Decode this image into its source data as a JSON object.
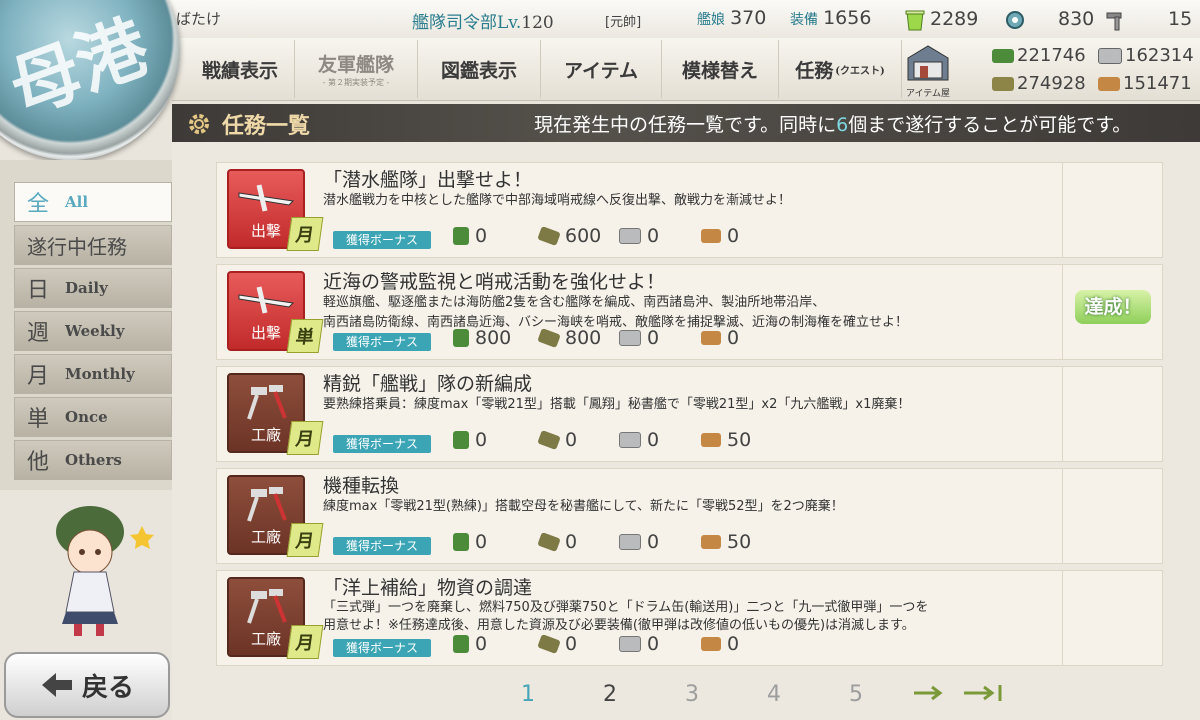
{
  "header": {
    "player_name": "ばたけ",
    "hq_label": "艦隊司令部",
    "level_prefix": "Lv.",
    "level": "120",
    "rank": "[元帥]",
    "ships_label": "艦娘",
    "ships": "370",
    "equip_label": "装備",
    "equip": "1656",
    "buckets": "2289",
    "dev_materials": "830",
    "screws": "15"
  },
  "nav": {
    "items": [
      {
        "label": "戦績表示"
      },
      {
        "label": "友軍艦隊",
        "sub": "- 第２期実装予定 -"
      },
      {
        "label": "図鑑表示"
      },
      {
        "label": "アイテム"
      },
      {
        "label": "模様替え"
      },
      {
        "label": "任務",
        "sub": "(クエスト)"
      }
    ],
    "item_shop_label": "アイテム屋"
  },
  "resources": {
    "fuel": "221746",
    "steel": "162314",
    "ammo": "274928",
    "bauxite": "151471"
  },
  "quest_header": {
    "title": "任務一覧",
    "msg_before": "現在発生中の任務一覧です。同時に",
    "msg_count": "6",
    "msg_after": "個まで遂行することが可能です。"
  },
  "filters": [
    {
      "kanji": "全",
      "label": "All"
    },
    {
      "kanji": "遂行中任務",
      "label": ""
    },
    {
      "kanji": "日",
      "label": "Daily"
    },
    {
      "kanji": "週",
      "label": "Weekly"
    },
    {
      "kanji": "月",
      "label": "Monthly"
    },
    {
      "kanji": "単",
      "label": "Once"
    },
    {
      "kanji": "他",
      "label": "Others"
    }
  ],
  "bonus_label": "獲得ボーナス",
  "quests": [
    {
      "category": "出撃",
      "tag": "月",
      "title": "「潜水艦隊」出撃せよ！",
      "desc": [
        "潜水艦戦力を中核とした艦隊で中部海域哨戒線へ反復出撃、敵戦力を漸減せよ！"
      ],
      "fuel": "0",
      "ammo": "600",
      "steel": "0",
      "baux": "0"
    },
    {
      "category": "出撃",
      "tag": "単",
      "title": "近海の警戒監視と哨戒活動を強化せよ！",
      "desc": [
        "軽巡旗艦、駆逐艦または海防艦2隻を含む艦隊を編成、南西諸島沖、製油所地帯沿岸、",
        "南西諸島防衛線、南西諸島近海、バシー海峡を哨戒、敵艦隊を捕捉撃滅、近海の制海権を確立せよ！"
      ],
      "fuel": "800",
      "ammo": "800",
      "steel": "0",
      "baux": "0"
    },
    {
      "category": "工廠",
      "tag": "月",
      "title": "精鋭「艦戦」隊の新編成",
      "desc": [
        "要熟練搭乗員：練度max「零戦21型」搭載「鳳翔」秘書艦で「零戦21型」x2「九六艦戦」x1廃棄！"
      ],
      "fuel": "0",
      "ammo": "0",
      "steel": "0",
      "baux": "50"
    },
    {
      "category": "工廠",
      "tag": "月",
      "title": "機種転換",
      "desc": [
        "練度max「零戦21型(熟練)」搭載空母を秘書艦にして、新たに「零戦52型」を2つ廃棄！"
      ],
      "fuel": "0",
      "ammo": "0",
      "steel": "0",
      "baux": "50"
    },
    {
      "category": "工廠",
      "tag": "月",
      "title": "「洋上補給」物資の調達",
      "desc": [
        "「三式弾」一つを廃棄し、燃料750及び弾薬750と「ドラム缶(輸送用)」二つと「九一式徹甲弾」一つを",
        "用意せよ！※任務達成後、用意した資源及び必要装備(徹甲弾は改修値の低いもの優先)は消滅します。"
      ],
      "fuel": "0",
      "ammo": "0",
      "steel": "0",
      "baux": "0"
    }
  ],
  "achieved_label": "達成！",
  "back_label": "戻る",
  "pages": [
    "1",
    "2",
    "3",
    "4",
    "5"
  ],
  "current_page": "1",
  "colors": {
    "accent": "#46a5b7",
    "header_bg": "#3d3a37",
    "sortie": "#c22a2a",
    "arsenal": "#6c3426"
  }
}
